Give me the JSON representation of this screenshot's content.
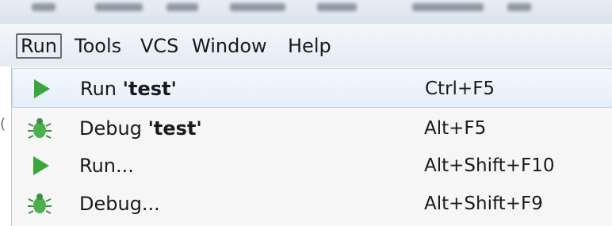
{
  "menubar": {
    "items": [
      {
        "label": "Run",
        "active": true
      },
      {
        "label": "Tools",
        "active": false
      },
      {
        "label": "VCS",
        "active": false
      },
      {
        "label": "Window",
        "active": false
      },
      {
        "label": "Help",
        "active": false
      }
    ]
  },
  "run_menu": {
    "items": [
      {
        "icon": "run-icon",
        "label": "Run ",
        "target": "'test'",
        "shortcut": "Ctrl+F5",
        "highlighted": true
      },
      {
        "icon": "debug-bug-icon",
        "label": "Debug ",
        "target": "'test'",
        "shortcut": "Alt+F5",
        "highlighted": false
      },
      {
        "icon": "run-icon",
        "label": "Run...",
        "target": "",
        "shortcut": "Alt+Shift+F10",
        "highlighted": false
      },
      {
        "icon": "debug-bug-icon",
        "label": "Debug...",
        "target": "",
        "shortcut": "Alt+Shift+F9",
        "highlighted": false
      }
    ]
  },
  "colors": {
    "run_green": "#3aa53a",
    "bug_green": "#4caf50",
    "highlight_border": "#bcd3ea"
  }
}
